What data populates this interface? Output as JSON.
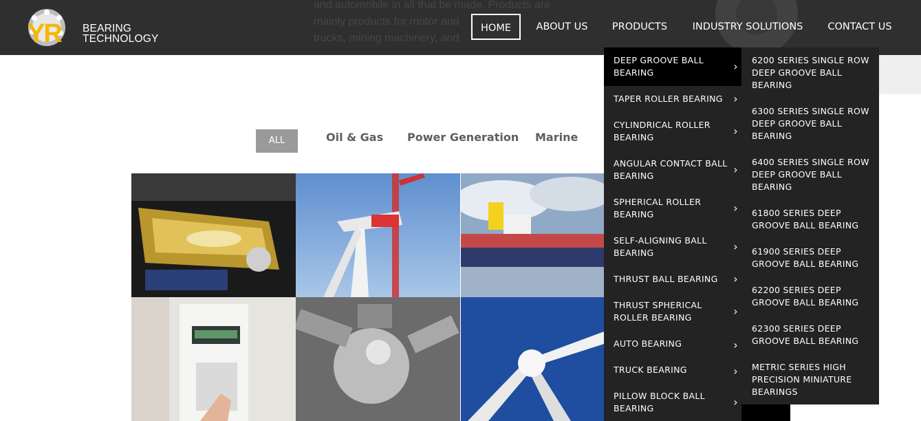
{
  "header": {
    "background_text": [
      "and automobile in all that be made. Products are",
      "mainly products for motor and",
      "trucks, mining machinery, and"
    ],
    "logo": {
      "initials": "YR",
      "line1": "BEARING",
      "line2": "TECHNOLOGY"
    },
    "nav": [
      {
        "label": "HOME",
        "active": true
      },
      {
        "label": "ABOUT US"
      },
      {
        "label": "PRODUCTS"
      },
      {
        "label": "INDUSTRY SOLUTIONS"
      },
      {
        "label": "CONTACT US"
      }
    ]
  },
  "filters": {
    "tabs": [
      "ALL",
      "Oil & Gas",
      "Power Generation",
      "Marine"
    ]
  },
  "gallery": {
    "tiles": [
      "engine-photo",
      "wind-turbine-crane-photo",
      "cargo-ship-photo",
      "lab-instrument-photo",
      "vacuum-chamber-photo",
      "wind-turbine-hub-photo"
    ]
  },
  "products_menu": {
    "items": [
      "DEEP GROOVE BALL BEARING",
      "TAPER ROLLER BEARING",
      "CYLINDRICAL ROLLER BEARING",
      "ANGULAR CONTACT BALL BEARING",
      "SPHERICAL ROLLER BEARING",
      "SELF-ALIGNING BALL BEARING",
      "THRUST BALL BEARING",
      "THRUST SPHERICAL ROLLER BEARING",
      "AUTO BEARING",
      "TRUCK BEARING",
      "PILLOW BLOCK BALL BEARING"
    ],
    "chevron": "›"
  },
  "submenu": {
    "items": [
      "6200 SERIES SINGLE ROW DEEP GROOVE BALL BEARING",
      "6300 SERIES SINGLE ROW DEEP GROOVE BALL BEARING",
      "6400 SERIES SINGLE ROW DEEP GROOVE BALL BEARING",
      "61800 SERIES DEEP GROOVE BALL BEARING",
      "61900 SERIES DEEP GROOVE BALL BEARING",
      "62200 SERIES DEEP GROOVE BALL BEARING",
      "62300 SERIES DEEP GROOVE BALL BEARING",
      "METRIC SERIES HIGH PRECISION MINIATURE BEARINGS"
    ]
  },
  "colors": {
    "header_bg": "#2f2f2f",
    "menu_bg": "#232323",
    "menu_active": "#000000",
    "logo_yellow": "#f5b700",
    "filter_active": "#9a9a9a"
  }
}
